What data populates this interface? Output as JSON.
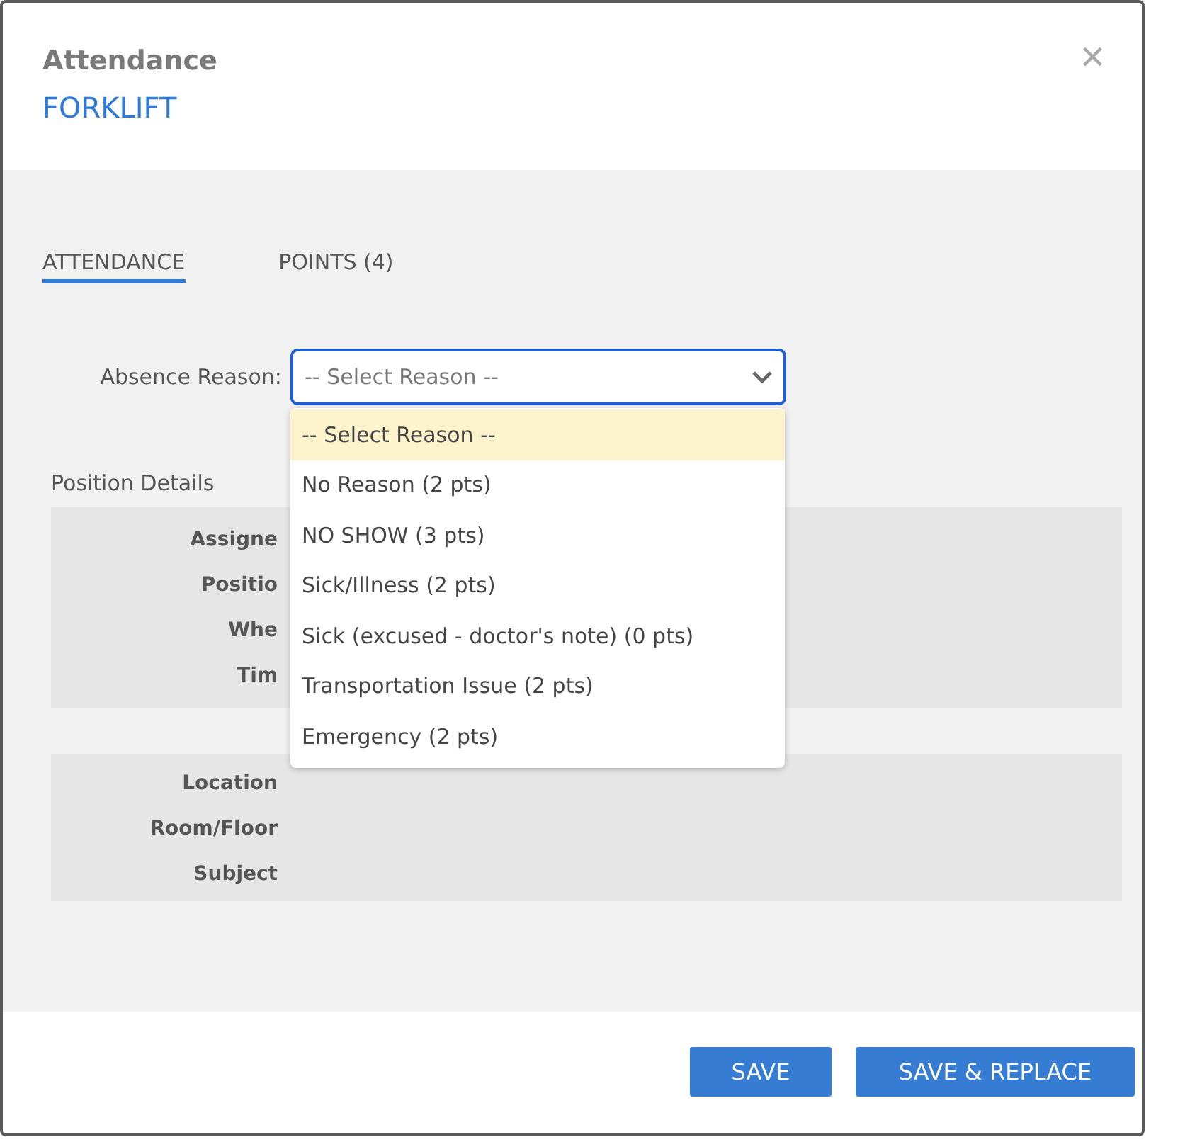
{
  "dialog": {
    "title": "Attendance",
    "subtitle": "FORKLIFT",
    "close": "×"
  },
  "tabs": [
    {
      "label": "ATTENDANCE",
      "selected": true
    },
    {
      "label": "POINTS (4)",
      "selected": false
    }
  ],
  "absence_reason": {
    "label": "Absence Reason:",
    "value": "-- Select Reason --",
    "open": true,
    "options": [
      {
        "label": "-- Select Reason --",
        "selected": true
      },
      {
        "label": "No Reason (2 pts)",
        "selected": false
      },
      {
        "label": "NO SHOW (3 pts)",
        "selected": false
      },
      {
        "label": "Sick/Illness (2 pts)",
        "selected": false
      },
      {
        "label": "Sick (excused - doctor's note) (0 pts)",
        "selected": false
      },
      {
        "label": "Transportation Issue (2 pts)",
        "selected": false
      },
      {
        "label": "Emergency (2 pts)",
        "selected": false
      }
    ]
  },
  "position_details": {
    "heading": "Position Details",
    "groups": [
      [
        "Assigne",
        "Positio",
        "Whe",
        "Tim"
      ],
      [
        "Location",
        "Room/Floor",
        "Subject"
      ]
    ]
  },
  "buttons": [
    "SAVE",
    "SAVE & REPLACE"
  ]
}
